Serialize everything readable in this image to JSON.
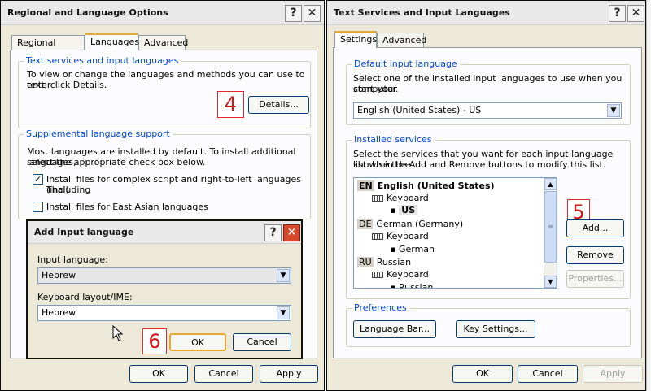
{
  "regional": {
    "title": "Regional and Language Options",
    "tabs": [
      "Regional Options",
      "Languages",
      "Advanced"
    ],
    "text_services": {
      "legend": "Text services and input languages",
      "desc": [
        "To view or change the languages and methods you can use to enter",
        "text, click Details."
      ],
      "annotation": "4",
      "details_button": "Details..."
    },
    "supplemental": {
      "legend": "Supplemental language support",
      "desc": [
        "Most languages are installed by default. To install additional languages,",
        "select the appropriate check box below."
      ],
      "check_complex": [
        "Install files for complex script and right-to-left languages (including",
        "Thai)"
      ],
      "check_complex_checked": true,
      "check_east_asian": "Install files for East Asian languages",
      "check_east_asian_checked": false
    },
    "ok": "OK",
    "cancel": "Cancel",
    "apply": "Apply"
  },
  "add_input": {
    "title": "Add Input language",
    "input_label": "Input language:",
    "input_value": "Hebrew",
    "keyboard_label": "Keyboard layout/IME:",
    "keyboard_value": "Hebrew",
    "annotation": "6",
    "ok": "OK",
    "cancel": "Cancel"
  },
  "text_services": {
    "title": "Text Services and Input Languages",
    "tabs": [
      "Settings",
      "Advanced"
    ],
    "default_input": {
      "legend": "Default input language",
      "desc": [
        "Select one of the installed input languages to use when you start your",
        "computer."
      ],
      "value": "English (United States) - US"
    },
    "installed": {
      "legend": "Installed services",
      "desc": [
        "Select the services that you want for each input language shown in the",
        "list. Use the Add and Remove buttons to modify this list."
      ],
      "tree": [
        {
          "code": "EN",
          "name": "English (United States)",
          "bold": true
        },
        {
          "kind": "keyboard",
          "label": "Keyboard"
        },
        {
          "kind": "layout",
          "label": "US",
          "bold": true
        },
        {
          "code": "DE",
          "name": "German (Germany)"
        },
        {
          "kind": "keyboard",
          "label": "Keyboard"
        },
        {
          "kind": "layout",
          "label": "German"
        },
        {
          "code": "RU",
          "name": "Russian"
        },
        {
          "kind": "keyboard",
          "label": "Keyboard"
        },
        {
          "kind": "layout",
          "label": "Russian"
        }
      ],
      "annotation": "5",
      "add": "Add...",
      "remove": "Remove",
      "properties": "Properties..."
    },
    "preferences": {
      "legend": "Preferences",
      "language_bar": "Language Bar...",
      "key_settings": "Key Settings..."
    },
    "ok": "OK",
    "cancel": "Cancel",
    "apply": "Apply"
  }
}
